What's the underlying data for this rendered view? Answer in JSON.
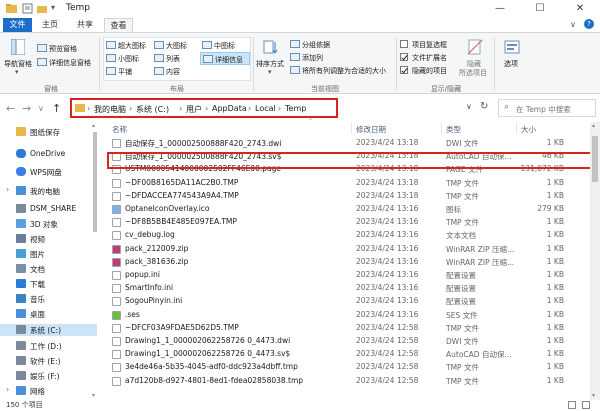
{
  "window": {
    "title": "Temp",
    "minimize": "—",
    "maximize": "☐",
    "close": "✕"
  },
  "tabs": {
    "file": "文件",
    "home": "主页",
    "share": "共享",
    "view": "查看"
  },
  "ribbon": {
    "panes": {
      "nav_pane": "导航窗格",
      "preview_pane": "预览窗格",
      "details_pane": "详细信息窗格",
      "group": "窗格"
    },
    "layout": {
      "extra_large": "超大图标",
      "large": "大图标",
      "medium": "中图标",
      "small": "小图标",
      "list": "列表",
      "details": "详细信息",
      "tiles": "平铺",
      "content": "内容",
      "group": "布局"
    },
    "current_view": {
      "sort_by": "排序方式",
      "group_by": "分组依据",
      "add_columns": "添加列",
      "size_all_columns": "将所有列调整为合适的大小",
      "group": "当前视图"
    },
    "show_hide": {
      "item_checkboxes": "项目复选框",
      "file_extensions": "文件扩展名",
      "hidden_items": "隐藏的项目",
      "hide_selected": "隐藏",
      "hide_selected2": "所选项目",
      "group": "显示/隐藏"
    },
    "options": "选项"
  },
  "address": {
    "crumbs": [
      "我的电脑",
      "系统 (C:)",
      "用户",
      "AppData",
      "Local",
      "Temp"
    ],
    "search_placeholder": "在 Temp 中搜索"
  },
  "nav": [
    {
      "icon": "folder-icon",
      "label": "图纸保存",
      "color": "#e8b84a"
    },
    {
      "icon": "cloud-icon",
      "label": "OneDrive",
      "color": "#2b7cd3"
    },
    {
      "icon": "cloud-icon",
      "label": "WPS网盘",
      "color": "#3d7ee6"
    },
    {
      "icon": "computer-icon",
      "label": "我的电脑",
      "color": "#4a90d9"
    },
    {
      "icon": "drive-icon",
      "label": "DSM_SHARE",
      "color": "#7a8a99"
    },
    {
      "icon": "cube-icon",
      "label": "3D 对象",
      "color": "#5ba0e0"
    },
    {
      "icon": "video-icon",
      "label": "视频",
      "color": "#6a7fa0"
    },
    {
      "icon": "picture-icon",
      "label": "图片",
      "color": "#4a9fd8"
    },
    {
      "icon": "document-icon",
      "label": "文档",
      "color": "#7a8fa6"
    },
    {
      "icon": "download-icon",
      "label": "下载",
      "color": "#2b7cd3"
    },
    {
      "icon": "music-icon",
      "label": "音乐",
      "color": "#3a82c4"
    },
    {
      "icon": "desktop-icon",
      "label": "桌面",
      "color": "#4a90d9"
    },
    {
      "icon": "drive-icon",
      "label": "系统 (C:)",
      "color": "#7a8a99"
    },
    {
      "icon": "drive-icon",
      "label": "工作 (D:)",
      "color": "#7a8a99"
    },
    {
      "icon": "drive-icon",
      "label": "软件 (E:)",
      "color": "#7a8a99"
    },
    {
      "icon": "drive-icon",
      "label": "娱乐 (F:)",
      "color": "#7a8a99"
    },
    {
      "icon": "network-icon",
      "label": "网络",
      "color": "#4a90d9"
    }
  ],
  "columns": {
    "name": "名称",
    "date": "修改日期",
    "type": "类型",
    "size": "大小"
  },
  "files": [
    {
      "name": "自动保存_1_000002500888F420_2743.dwi",
      "date": "2023/4/24 13:18",
      "type": "DWI 文件",
      "size": "1 KB",
      "icon_color": "#ffffff"
    },
    {
      "name": "自动保存_1_000002500888F420_2743.sv$",
      "date": "2023/4/24 13:18",
      "type": "AutoCAD 自动保...",
      "size": "46 KB",
      "icon_color": "#ffffff"
    },
    {
      "name": "USTM00005414000002502FF46E00.page",
      "date": "2023/4/24 13:18",
      "type": "PAGE 文件",
      "size": "131,072 KB",
      "icon_color": "#ffffff"
    },
    {
      "name": "~DF00B8165DA11AC2B0.TMP",
      "date": "2023/4/24 13:18",
      "type": "TMP 文件",
      "size": "1 KB",
      "icon_color": "#ffffff"
    },
    {
      "name": "~DFDACCEA774543A9A4.TMP",
      "date": "2023/4/24 13:18",
      "type": "TMP 文件",
      "size": "1 KB",
      "icon_color": "#ffffff"
    },
    {
      "name": "OptaneIconOverlay.ico",
      "date": "2023/4/24 13:16",
      "type": "图标",
      "size": "279 KB",
      "icon_color": "#7fb3e6"
    },
    {
      "name": "~DF8B5BB4E485E097EA.TMP",
      "date": "2023/4/24 13:16",
      "type": "TMP 文件",
      "size": "1 KB",
      "icon_color": "#ffffff"
    },
    {
      "name": "cv_debug.log",
      "date": "2023/4/24 13:16",
      "type": "文本文档",
      "size": "1 KB",
      "icon_color": "#ffffff"
    },
    {
      "name": "pack_212009.zip",
      "date": "2023/4/24 13:16",
      "type": "WinRAR ZIP 压缩...",
      "size": "1 KB",
      "icon_color": "#c23b7a"
    },
    {
      "name": "pack_381636.zip",
      "date": "2023/4/24 13:16",
      "type": "WinRAR ZIP 压缩...",
      "size": "1 KB",
      "icon_color": "#c23b7a"
    },
    {
      "name": "popup.ini",
      "date": "2023/4/24 13:16",
      "type": "配置设置",
      "size": "1 KB",
      "icon_color": "#ffffff"
    },
    {
      "name": "SmartInfo.ini",
      "date": "2023/4/24 13:16",
      "type": "配置设置",
      "size": "1 KB",
      "icon_color": "#ffffff"
    },
    {
      "name": "SogouPinyin.ini",
      "date": "2023/4/24 13:16",
      "type": "配置设置",
      "size": "1 KB",
      "icon_color": "#ffffff"
    },
    {
      "name": ".ses",
      "date": "2023/4/24 13:16",
      "type": "SES 文件",
      "size": "1 KB",
      "icon_color": "#6bbf3a"
    },
    {
      "name": "~DFCF03A9FDAE5D62D5.TMP",
      "date": "2023/4/24 12:58",
      "type": "TMP 文件",
      "size": "1 KB",
      "icon_color": "#ffffff"
    },
    {
      "name": "Drawing1_1_000002062258726 0_4473.dwi",
      "date": "2023/4/24 12:58",
      "type": "DWI 文件",
      "size": "1 KB",
      "icon_color": "#ffffff"
    },
    {
      "name": "Drawing1_1_000002062258726 0_4473.sv$",
      "date": "2023/4/24 12:58",
      "type": "AutoCAD 自动保...",
      "size": "1 KB",
      "icon_color": "#ffffff"
    },
    {
      "name": "3e4de46a-5b35-4045-adf0-ddc923a4dbff.tmp",
      "date": "2023/4/24 12:58",
      "type": "TMP 文件",
      "size": "1 KB",
      "icon_color": "#ffffff"
    },
    {
      "name": "a7d120b8-d927-4801-8ed1-fdea02858038.tmp",
      "date": "2023/4/24 12:58",
      "type": "TMP 文件",
      "size": "1 KB",
      "icon_color": "#ffffff"
    }
  ],
  "status": {
    "count": "150 个项目"
  },
  "colors": {
    "accent": "#1a6ec7",
    "highlight": "#dd2222",
    "selection": "#cce4f7"
  }
}
